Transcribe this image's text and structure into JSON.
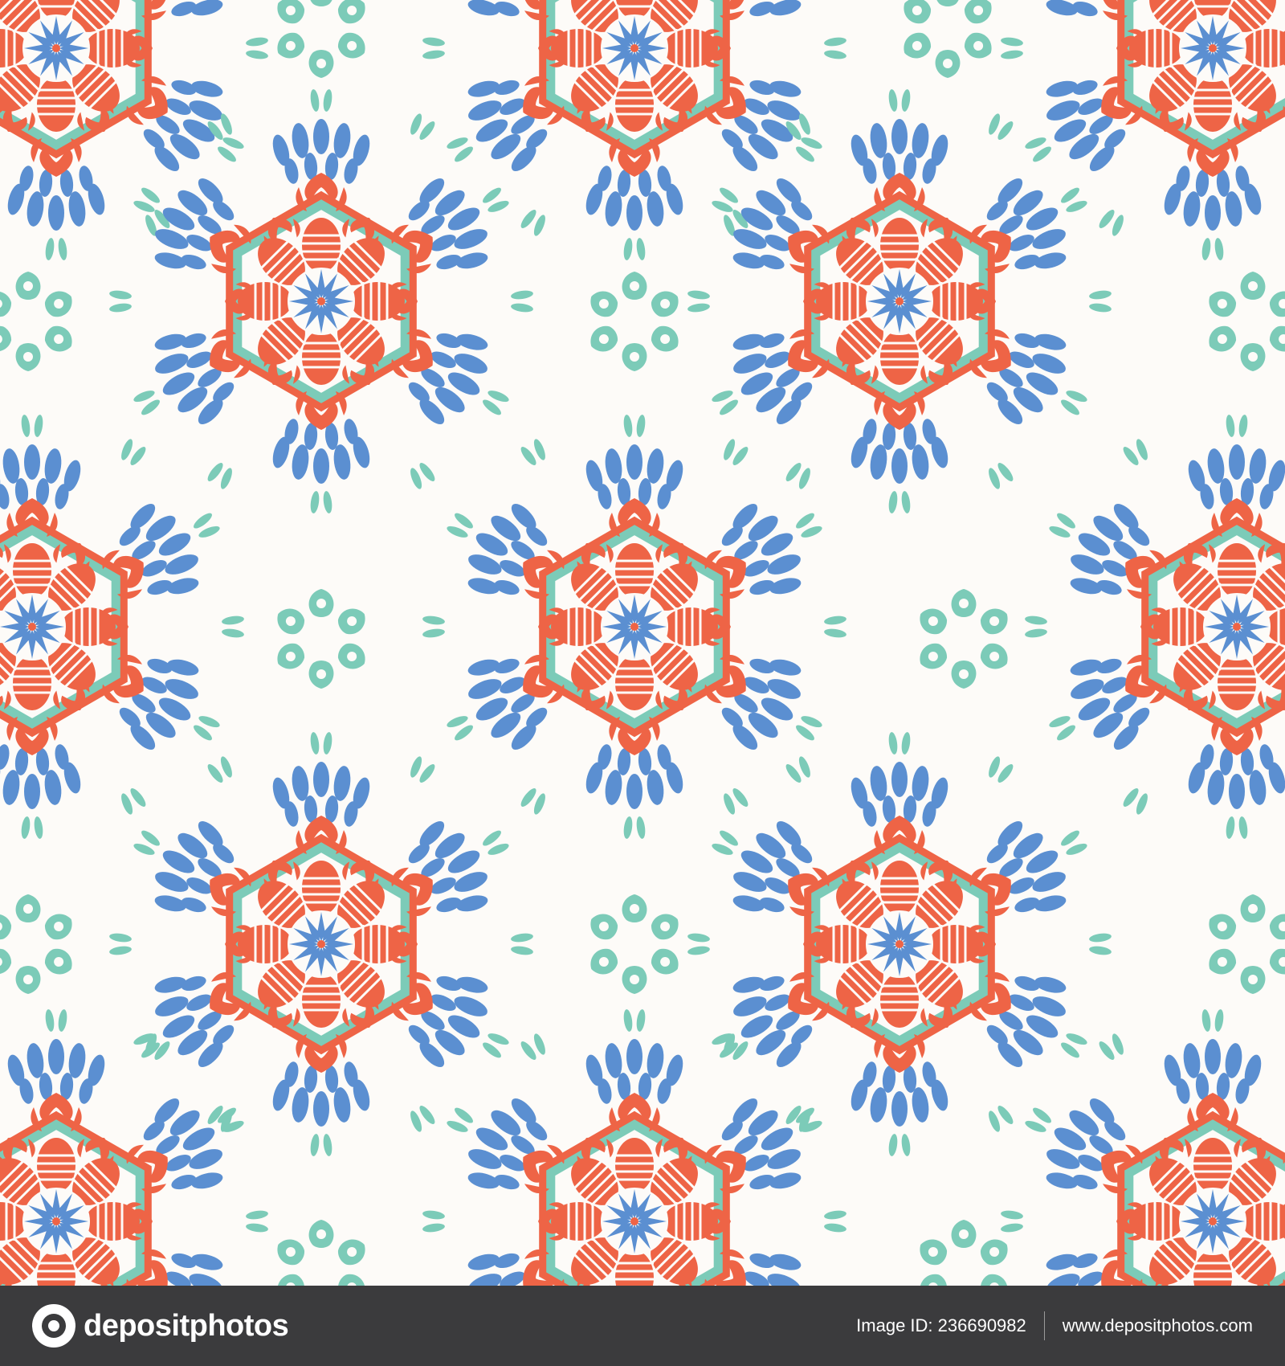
{
  "pattern": {
    "colors": {
      "background": "#fdfbf8",
      "blue": "#5b8fd1",
      "coral": "#ee6446",
      "mint": "#7ccbb8"
    }
  },
  "footer": {
    "logo_text": "depositphotos",
    "image_id": "Image ID: 236690982",
    "site_url": "www.depositphotos.com"
  }
}
